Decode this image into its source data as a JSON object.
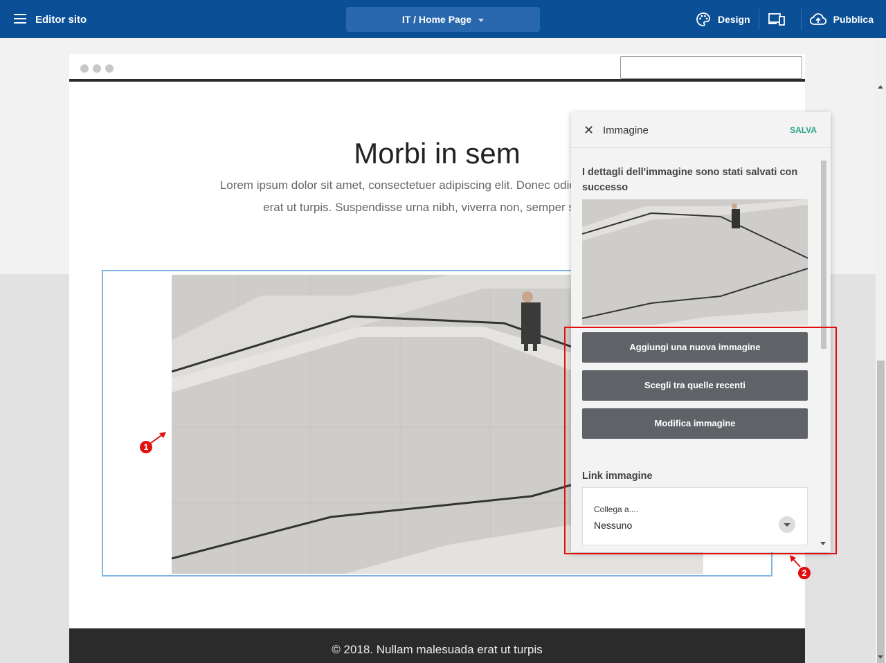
{
  "topbar": {
    "app_title": "Editor sito",
    "page_selector": "IT / Home Page",
    "design_label": "Design",
    "publish_label": "Pubblica"
  },
  "site": {
    "title": "Morbi in sem",
    "text_line1": "Lorem ipsum dolor sit amet, consectetuer adipiscing elit. Donec odio. Quisque volut",
    "text_line2": "erat ut turpis. Suspendisse urna nibh, viverra non, semper suscipit,",
    "footer": "© 2018. Nullam malesuada erat ut turpis"
  },
  "panel": {
    "title": "Immagine",
    "save_label": "SALVA",
    "success_message": "I dettagli dell'immagine sono stati salvati con successo",
    "buttons": [
      "Aggiungi una nuova immagine",
      "Scegli tra quelle recenti",
      "Modifica immagine"
    ],
    "link_section_label": "Link immagine",
    "link_field_label": "Collega a....",
    "link_field_value": "Nessuno"
  },
  "annotations": {
    "marker_1": "1",
    "marker_2": "2"
  },
  "colors": {
    "topbar": "#0b4f96",
    "accent_save": "#2aa58a",
    "highlight": "#e01010",
    "selection": "#7db4e8"
  }
}
